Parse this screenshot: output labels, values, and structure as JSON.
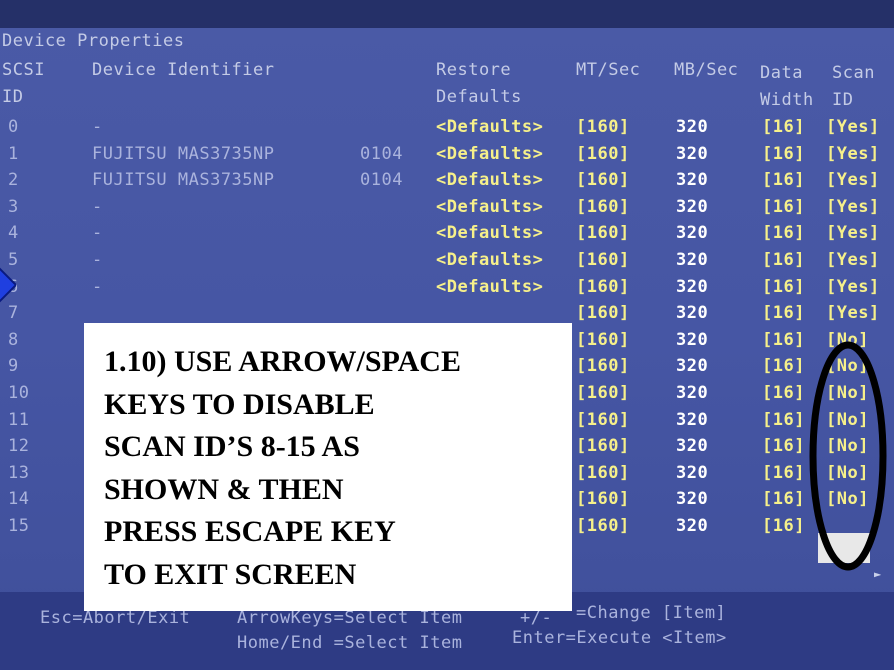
{
  "screen_title": "Device Properties",
  "columns": {
    "scsi_id_1": "SCSI",
    "scsi_id_2": "ID",
    "device_identifier": "Device Identifier",
    "restore_1": "Restore",
    "restore_2": "Defaults",
    "mt_sec": "MT/Sec",
    "mb_sec": "MB/Sec",
    "data_width_1": "Data",
    "data_width_2": "Width",
    "scan_id_1": "Scan",
    "scan_id_2": "ID"
  },
  "rows": [
    {
      "id": "0",
      "device": "-",
      "rev": "",
      "restore": "<Defaults>",
      "mt": "[160]",
      "mb": "320",
      "width": "[16]",
      "scan": "[Yes]"
    },
    {
      "id": "1",
      "device": "FUJITSU MAS3735NP",
      "rev": "0104",
      "restore": "<Defaults>",
      "mt": "[160]",
      "mb": "320",
      "width": "[16]",
      "scan": "[Yes]"
    },
    {
      "id": "2",
      "device": "FUJITSU MAS3735NP",
      "rev": "0104",
      "restore": "<Defaults>",
      "mt": "[160]",
      "mb": "320",
      "width": "[16]",
      "scan": "[Yes]"
    },
    {
      "id": "3",
      "device": "-",
      "rev": "",
      "restore": "<Defaults>",
      "mt": "[160]",
      "mb": "320",
      "width": "[16]",
      "scan": "[Yes]"
    },
    {
      "id": "4",
      "device": "-",
      "rev": "",
      "restore": "<Defaults>",
      "mt": "[160]",
      "mb": "320",
      "width": "[16]",
      "scan": "[Yes]"
    },
    {
      "id": "5",
      "device": "-",
      "rev": "",
      "restore": "<Defaults>",
      "mt": "[160]",
      "mb": "320",
      "width": "[16]",
      "scan": "[Yes]"
    },
    {
      "id": "6",
      "device": "-",
      "rev": "",
      "restore": "<Defaults>",
      "mt": "[160]",
      "mb": "320",
      "width": "[16]",
      "scan": "[Yes]"
    },
    {
      "id": "7",
      "device": "",
      "rev": "",
      "restore": "",
      "mt": "[160]",
      "mb": "320",
      "width": "[16]",
      "scan": "[Yes]"
    },
    {
      "id": "8",
      "device": "",
      "rev": "",
      "restore": "",
      "mt": "[160]",
      "mb": "320",
      "width": "[16]",
      "scan": "[No]"
    },
    {
      "id": "9",
      "device": "",
      "rev": "",
      "restore": "",
      "mt": "[160]",
      "mb": "320",
      "width": "[16]",
      "scan": "[No]"
    },
    {
      "id": "10",
      "device": "",
      "rev": "",
      "restore": "",
      "mt": "[160]",
      "mb": "320",
      "width": "[16]",
      "scan": "[No]"
    },
    {
      "id": "11",
      "device": "",
      "rev": "",
      "restore": "",
      "mt": "[160]",
      "mb": "320",
      "width": "[16]",
      "scan": "[No]"
    },
    {
      "id": "12",
      "device": "",
      "rev": "",
      "restore": "",
      "mt": "[160]",
      "mb": "320",
      "width": "[16]",
      "scan": "[No]"
    },
    {
      "id": "13",
      "device": "",
      "rev": "",
      "restore": "",
      "mt": "[160]",
      "mb": "320",
      "width": "[16]",
      "scan": "[No]"
    },
    {
      "id": "14",
      "device": "",
      "rev": "",
      "restore": "",
      "mt": "[160]",
      "mb": "320",
      "width": "[16]",
      "scan": "[No]"
    },
    {
      "id": "15",
      "device": "",
      "rev": "",
      "restore": "",
      "mt": "[160]",
      "mb": "320",
      "width": "[16]",
      "scan": ""
    }
  ],
  "footer": {
    "esc": "Esc=Abort/Exit",
    "arrowkeys": "ArrowKeys=Select Item",
    "change": "=Change [Item]",
    "change_keys": "+/-",
    "home_end": "Home/End =Select Item",
    "enter": "Enter=Execute <Item>"
  },
  "annotation": {
    "lines": [
      "1.10) USE ARROW/SPACE",
      "KEYS TO DISABLE",
      "SCAN ID’S 8-15 AS",
      "SHOWN & THEN",
      "PRESS ESCAPE KEY",
      "TO EXIT SCREEN"
    ]
  },
  "colors": {
    "screen_bg": "#4656a4",
    "value_yellow": "#f6f08a",
    "annotation_ellipse": "#000000",
    "annotation_arrow": "#1f3fe0"
  }
}
